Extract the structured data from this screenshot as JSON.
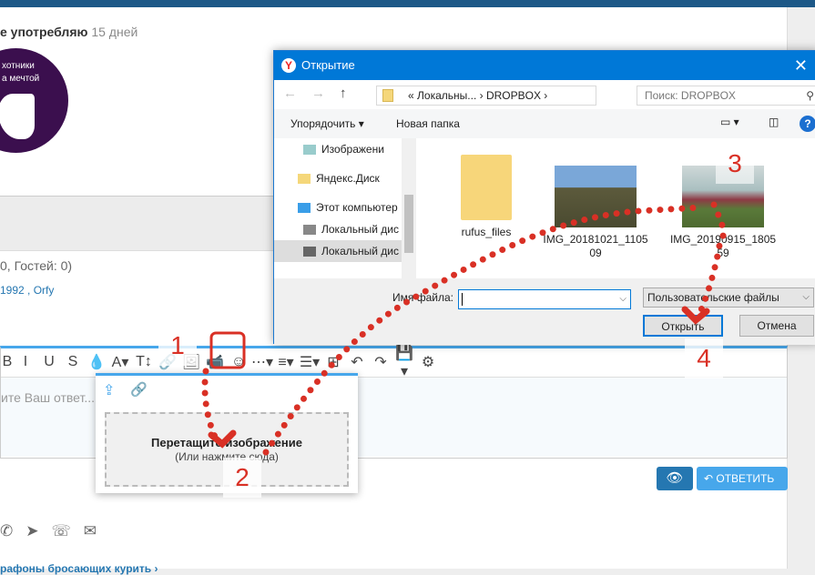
{
  "post": {
    "signature_bold": "е употребляю",
    "signature_days": "15 дней",
    "logo_line1": "хотники",
    "logo_line2": "а мечтой"
  },
  "online": {
    "text": "0, Гостей: 0)",
    "users": "1992 , Orfy"
  },
  "editor": {
    "placeholder": "ите Ваш ответ...",
    "toolbar": [
      "B",
      "I",
      "U",
      "S",
      "💧",
      "A▾",
      "T↕",
      "🔗",
      "🖼",
      "📹",
      "☺",
      "⋯▾",
      "≡▾",
      "☰▾",
      "⊞",
      "↶",
      "↷",
      "💾▾",
      "⚙"
    ]
  },
  "image_popup": {
    "drop_title": "Перетащите изображение",
    "drop_sub": "(Или нажмите сюда)"
  },
  "buttons": {
    "reply": "ОТВЕТИТЬ"
  },
  "breadcrumb": "рафоны бросающих курить",
  "dialog": {
    "title": "Открытие",
    "path": [
      "«",
      "Локальны...",
      "DROPBOX"
    ],
    "search_placeholder": "Поиск: DROPBOX",
    "organize": "Упорядочить",
    "new_folder": "Новая папка",
    "nav": [
      "Изображени",
      "Яндекс.Диск",
      "Этот компьютер",
      "Локальный дис",
      "Локальный дис"
    ],
    "files": [
      {
        "name": "rufus_files"
      },
      {
        "name": "IMG_20181021_110509"
      },
      {
        "name": "IMG_20190915_180559"
      }
    ],
    "filename_label": "Имя файла:",
    "filename_value": "",
    "filetype": "Пользовательские файлы",
    "open": "Открыть",
    "cancel": "Отмена"
  },
  "annotations": [
    "1",
    "2",
    "3",
    "4"
  ],
  "colors": {
    "accent": "#47a7eb",
    "dialog_title": "#0078d7",
    "annotation": "#d93025"
  }
}
